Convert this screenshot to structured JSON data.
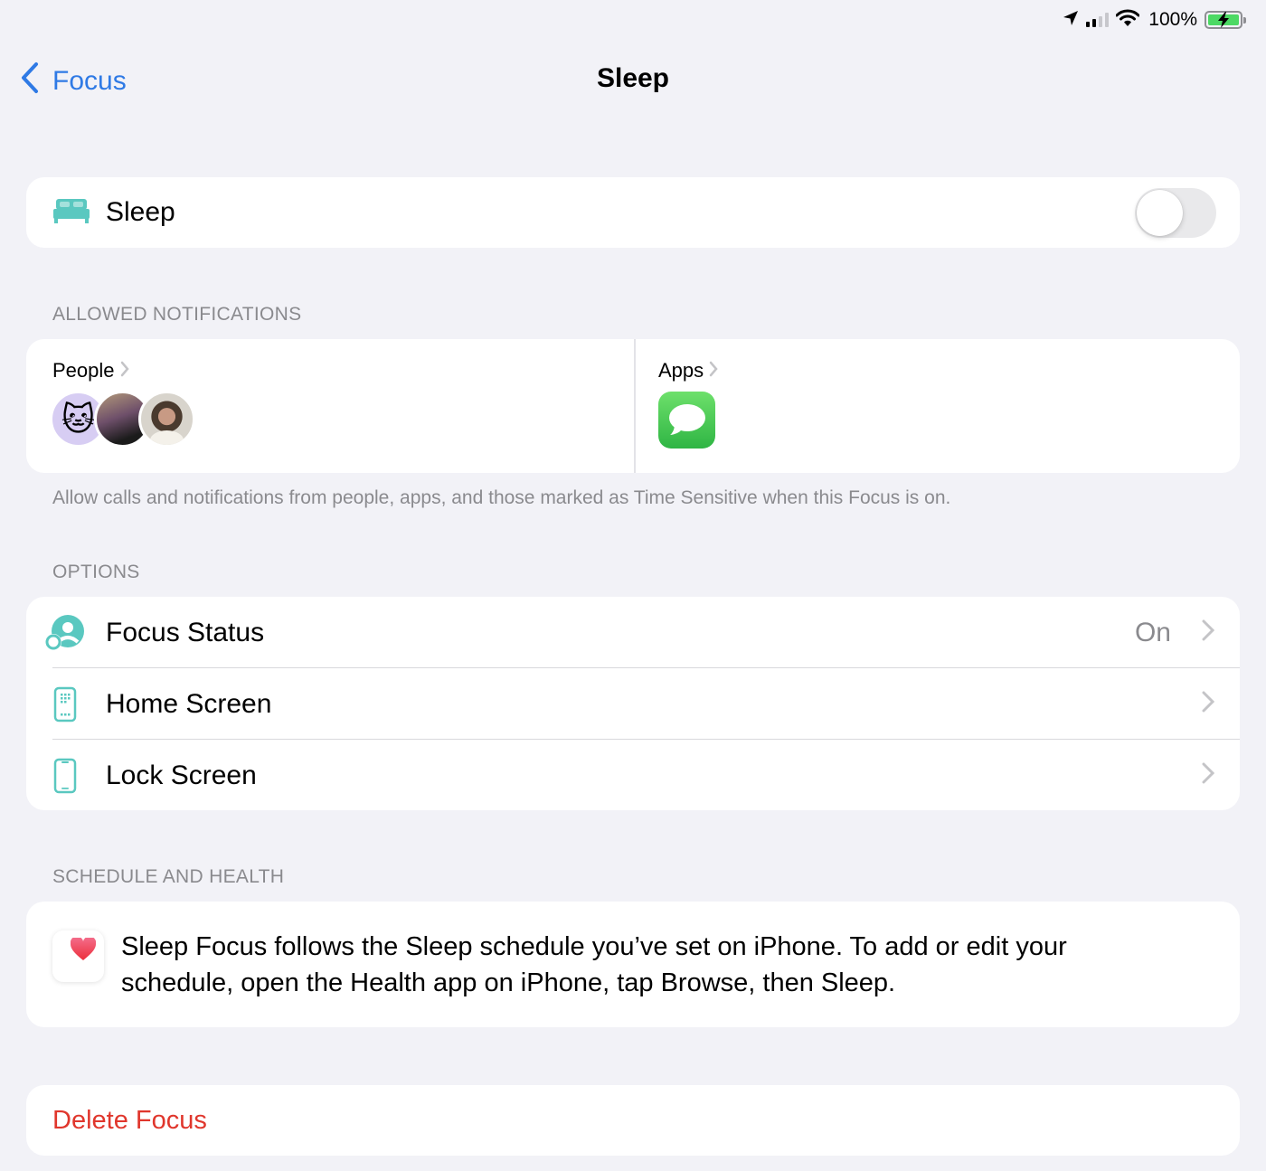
{
  "status_bar": {
    "icons": [
      "location-arrow-icon",
      "cellular-signal-icon",
      "wifi-icon",
      "battery-charging-icon"
    ],
    "battery_percent": "100%",
    "signal_bars": 2,
    "signal_bars_total": 4,
    "battery_level": 1.0,
    "battery_fill_color": "#4cd964"
  },
  "nav": {
    "back_label": "Focus",
    "title": "Sleep",
    "accent_color": "#2f7ae5"
  },
  "focus_toggle": {
    "icon": "bed-icon",
    "label": "Sleep",
    "enabled": false
  },
  "allowed_notifications": {
    "header": "ALLOWED NOTIFICATIONS",
    "people": {
      "label": "People",
      "avatars": [
        {
          "type": "memoji",
          "icon": "cat-memoji",
          "glyph": "🐱"
        },
        {
          "type": "photo",
          "icon": "contact-photo"
        },
        {
          "type": "photo",
          "icon": "contact-photo"
        }
      ]
    },
    "apps": {
      "label": "Apps",
      "items": [
        {
          "name": "Messages",
          "icon": "messages-app-icon"
        }
      ]
    },
    "footer": "Allow calls and notifications from people, apps, and those marked as Time Sensitive when this Focus is on."
  },
  "options": {
    "header": "OPTIONS",
    "rows": [
      {
        "label": "Focus Status",
        "value": "On",
        "icon": "focus-status-icon"
      },
      {
        "label": "Home Screen",
        "value": "",
        "icon": "home-screen-icon"
      },
      {
        "label": "Lock Screen",
        "value": "",
        "icon": "lock-screen-icon"
      }
    ]
  },
  "schedule": {
    "header": "SCHEDULE AND HEALTH",
    "icon": "health-heart-icon",
    "text": "Sleep Focus follows the Sleep schedule you’ve set on iPhone. To add or edit your schedule, open the Health app on iPhone, tap Browse, then Sleep."
  },
  "delete": {
    "label": "Delete Focus",
    "color": "#e0362c"
  },
  "theme": {
    "teal": "#5ac8c0",
    "background": "#f2f2f7"
  }
}
